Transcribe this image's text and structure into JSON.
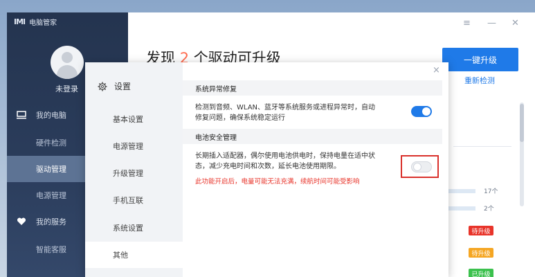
{
  "app": {
    "title": "电脑管家",
    "logo_text": "IMI"
  },
  "sidebar": {
    "login_label": "未登录",
    "items": [
      {
        "label": "我的电脑",
        "type": "main",
        "icon": "monitor-icon"
      },
      {
        "label": "硬件检测",
        "type": "sub"
      },
      {
        "label": "驱动管理",
        "type": "sub",
        "active": true
      },
      {
        "label": "电源管理",
        "type": "sub"
      },
      {
        "label": "我的服务",
        "type": "main",
        "icon": "heart-icon"
      },
      {
        "label": "智能客服",
        "type": "sub"
      }
    ]
  },
  "main": {
    "headline_prefix": "发现 ",
    "headline_count": "2",
    "headline_suffix": " 个驱动可升级",
    "primary_button": "一键升级",
    "recheck_link": "重新检测",
    "counts": [
      "17个",
      "2个"
    ],
    "badges": [
      {
        "label": "待升级",
        "color": "#e8342a"
      },
      {
        "label": "待升级",
        "color": "#f5a623"
      },
      {
        "label": "已升级",
        "color": "#3cc14e"
      }
    ],
    "window_controls": {
      "menu": "≡",
      "minimize": "—",
      "close": "✕"
    }
  },
  "dialog": {
    "title": "设置",
    "close": "×",
    "menu": [
      {
        "label": "基本设置"
      },
      {
        "label": "电源管理"
      },
      {
        "label": "升级管理"
      },
      {
        "label": "手机互联"
      },
      {
        "label": "系统设置"
      },
      {
        "label": "其他",
        "active": true
      }
    ],
    "sections": [
      {
        "header": "系统异常修复",
        "desc_line1": "检测到音频、WLAN、蓝牙等系统服务或进程异常时，自动",
        "desc_line2": "修复问题，确保系统稳定运行",
        "toggle_on": true
      },
      {
        "header": "电池安全管理",
        "desc_line1": "长期插入适配器，偶尔使用电池供电时，保持电量在适中状",
        "desc_line2": "态，减少充电时间和次数，延长电池使用期限。",
        "warning": "此功能开启后，电量可能无法充满，续航时间可能受影响",
        "toggle_on": false
      }
    ]
  },
  "colors": {
    "accent": "#1f7ae8",
    "highlight_border": "#d9302b",
    "warning_text": "#e8342a"
  }
}
